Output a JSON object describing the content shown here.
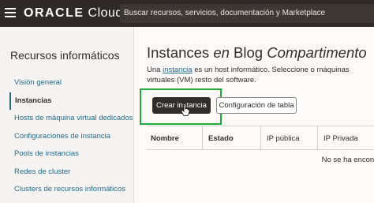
{
  "topbar": {
    "brand": "ORACLE",
    "product": "Cloud",
    "search_placeholder": "Buscar recursos, servicios, documentación y Marketplace"
  },
  "sidebar": {
    "title": "Recursos informáticos",
    "items": [
      {
        "label": "Visión general",
        "active": false
      },
      {
        "label": "Instancias",
        "active": true
      },
      {
        "label": "Hosts de máquina virtual dedicados",
        "active": false
      },
      {
        "label": "Configuraciones de instancia",
        "active": false
      },
      {
        "label": "Pools de instancias",
        "active": false
      },
      {
        "label": "Redes de cluster",
        "active": false
      },
      {
        "label": "Clusters de recursos informáticos",
        "active": false
      }
    ]
  },
  "main": {
    "title_part1": "Instances",
    "title_part2": "en",
    "title_part3": "Blog",
    "title_part4": "Compartimento",
    "desc_prefix": "Una",
    "desc_link": "instancia",
    "desc_rest": "es un host informático. Seleccione o máquinas virtuales (VM) resto del software.",
    "create_button": "Crear instancia",
    "table_settings_button": "Configuración de tabla",
    "columns": [
      "Nombre",
      "Estado",
      "IP pública",
      "IP Privada"
    ],
    "empty_message": "No se ha encontr"
  },
  "colors": {
    "topbar": "#2f2a27",
    "link": "#1f6b87",
    "highlight": "#22a93a",
    "primary_button": "#312d2a"
  }
}
